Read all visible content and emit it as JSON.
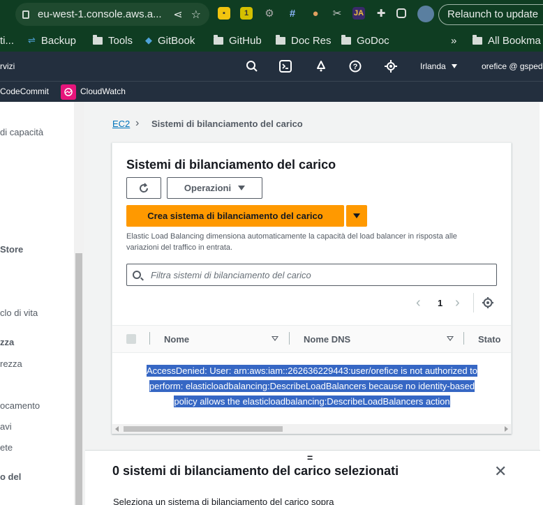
{
  "browser": {
    "url": "eu-west-1.console.aws.a...",
    "relaunch_label": "Relaunch to update",
    "bookmarks": [
      "ti...",
      "Backup",
      "Tools",
      "GitBook",
      "GitHub",
      "Doc Res",
      "GoDoc",
      "»",
      "All Bookma"
    ]
  },
  "aws_header": {
    "services_fragment": "rvizi",
    "region": "Irlanda",
    "account": "orefice @ gsped",
    "favorites": [
      "CodeCommit",
      "CloudWatch"
    ]
  },
  "sidebar": {
    "items": [
      "di capacità",
      "Store",
      "clo di vita",
      "zza",
      "rezza",
      "ocamento",
      "avi",
      "ete",
      "o del"
    ]
  },
  "breadcrumb": {
    "root": "EC2",
    "current": "Sistemi di bilanciamento del carico"
  },
  "panel": {
    "title": "Sistemi di bilanciamento del carico",
    "operations_label": "Operazioni",
    "create_label": "Crea sistema di bilanciamento del carico",
    "description_line1": "Elastic Load Balancing dimensiona automaticamente la capacità del load balancer in risposta alle",
    "description_line2": "variazioni del traffico in entrata.",
    "filter_placeholder": "Filtra sistemi di bilanciamento del carico",
    "page": "1"
  },
  "table": {
    "columns": [
      "Nome",
      "Nome DNS",
      "Stato"
    ],
    "error_lines": [
      "AccessDenied: User: arn:aws:iam::262636229443:user/orefice is not authorized to",
      "perform: elasticloadbalancing:DescribeLoadBalancers because no identity-based",
      "policy allows the elasticloadbalancing:DescribeLoadBalancers action"
    ]
  },
  "bottom": {
    "splitter": "=",
    "title": "0 sistemi di bilanciamento del carico selezionati",
    "close": "✕",
    "subtitle": "Seleziona un sistema di bilanciamento del carico sopra"
  },
  "colors": {
    "accent_orange": "#ff9900",
    "link_blue": "#0073bb",
    "selection_blue": "#3667c4",
    "aws_header": "#232f3e",
    "browser_frame": "#0f3d22"
  },
  "icons": [
    "lock-icon",
    "share-icon",
    "star-icon",
    "refresh-icon",
    "search-icon",
    "terminal-icon",
    "bell-icon",
    "help-icon",
    "settings-icon",
    "gear-icon",
    "close-icon"
  ]
}
